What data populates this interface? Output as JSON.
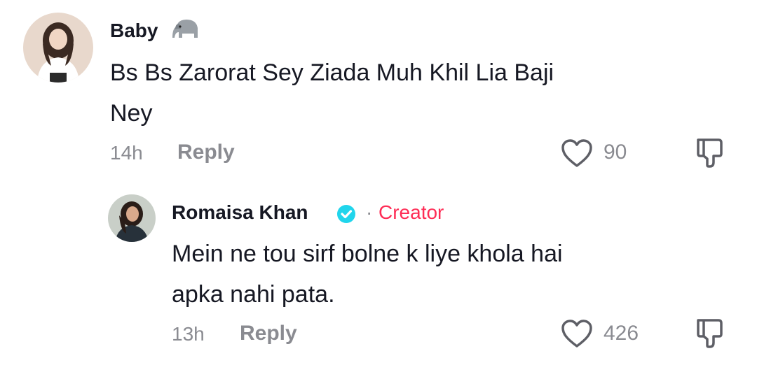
{
  "comments": [
    {
      "username": "Baby",
      "username_emoji": "elephant-icon",
      "text_line1": "Bs Bs Zarorat Sey Ziada Muh Khil Lia Baji",
      "text_line2": "Ney",
      "time": "14h",
      "reply_label": "Reply",
      "likes": "90"
    },
    {
      "username": "Romaisa Khan",
      "verified": true,
      "separator": "·",
      "creator_label": "Creator",
      "text_line1": "Mein ne tou sirf bolne k liye khola hai",
      "text_line2": "apka nahi pata.",
      "time": "13h",
      "reply_label": "Reply",
      "likes": "426"
    }
  ],
  "colors": {
    "text": "#161823",
    "muted": "#8a8b91",
    "creator": "#fe2c55",
    "verified": "#20d5ec"
  }
}
